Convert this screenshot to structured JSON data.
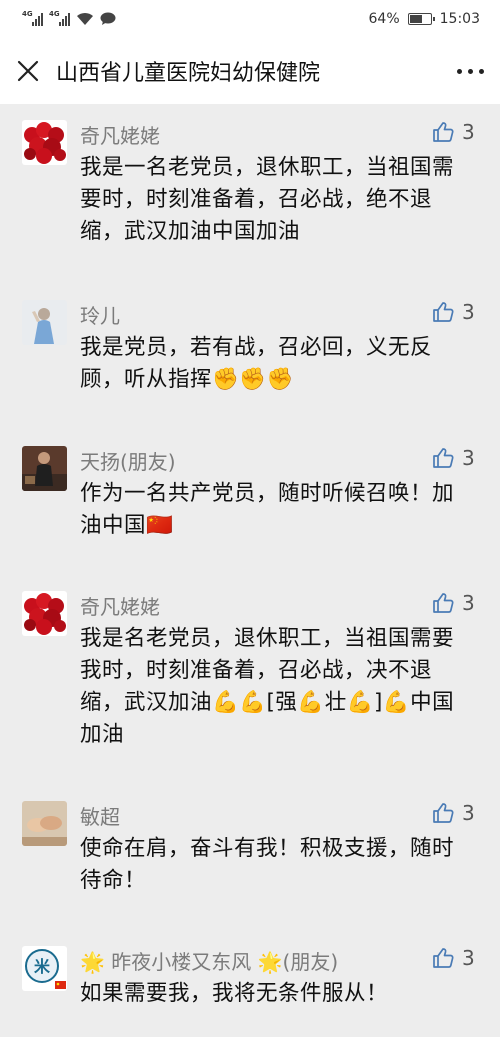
{
  "status_bar": {
    "network1": "4G",
    "network2": "4G",
    "battery": "64%",
    "battery_level": 0.64,
    "time": "15:03"
  },
  "header": {
    "title": "山西省儿童医院妇幼保健院"
  },
  "comments": [
    {
      "name": "奇凡姥姥",
      "likes": "3",
      "text": "我是一名老党员，退休职工，当祖国需要时，时刻准备着，召必战，绝不退缩，武汉加油中国加油",
      "avatar": "roses"
    },
    {
      "name": "玲儿",
      "likes": "3",
      "text": "我是党员，若有战，召必回，义无反顾，听从指挥✊✊✊",
      "avatar": "girl"
    },
    {
      "name": "天扬(朋友)",
      "likes": "3",
      "text": "作为一名共产党员，随时听候召唤！加油中国🇨🇳",
      "avatar": "man"
    },
    {
      "name": "奇凡姥姥",
      "likes": "3",
      "text": "我是名老党员，退休职工，当祖国需要我时，时刻准备着，召必战，决不退缩，武汉加油💪💪[强💪壮💪]💪中国加油",
      "avatar": "roses"
    },
    {
      "name": "敏超",
      "likes": "3",
      "text": "使命在肩，奋斗有我！积极支援，随时待命！",
      "avatar": "hands"
    },
    {
      "name": "🌟 昨夜小楼又东风 🌟(朋友)",
      "likes": "3",
      "text": "如果需要我，我将无条件服从！",
      "avatar": "mi-logo"
    }
  ]
}
